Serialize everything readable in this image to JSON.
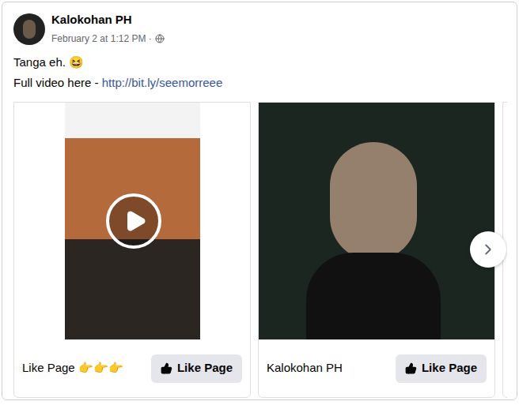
{
  "post": {
    "author": "Kalokohan PH",
    "timestamp": "February 2 at 1:12 PM ·",
    "message": "Tanga eh. 😆",
    "link_prefix": "Full video here - ",
    "link": "http://bit.ly/seemorreee"
  },
  "carousel": {
    "cards": [
      {
        "kind": "video",
        "caption": "Like Page 👉👉👉",
        "button": "Like Page"
      },
      {
        "kind": "photo",
        "caption": "Kalokohan PH",
        "button": "Like Page"
      }
    ]
  }
}
